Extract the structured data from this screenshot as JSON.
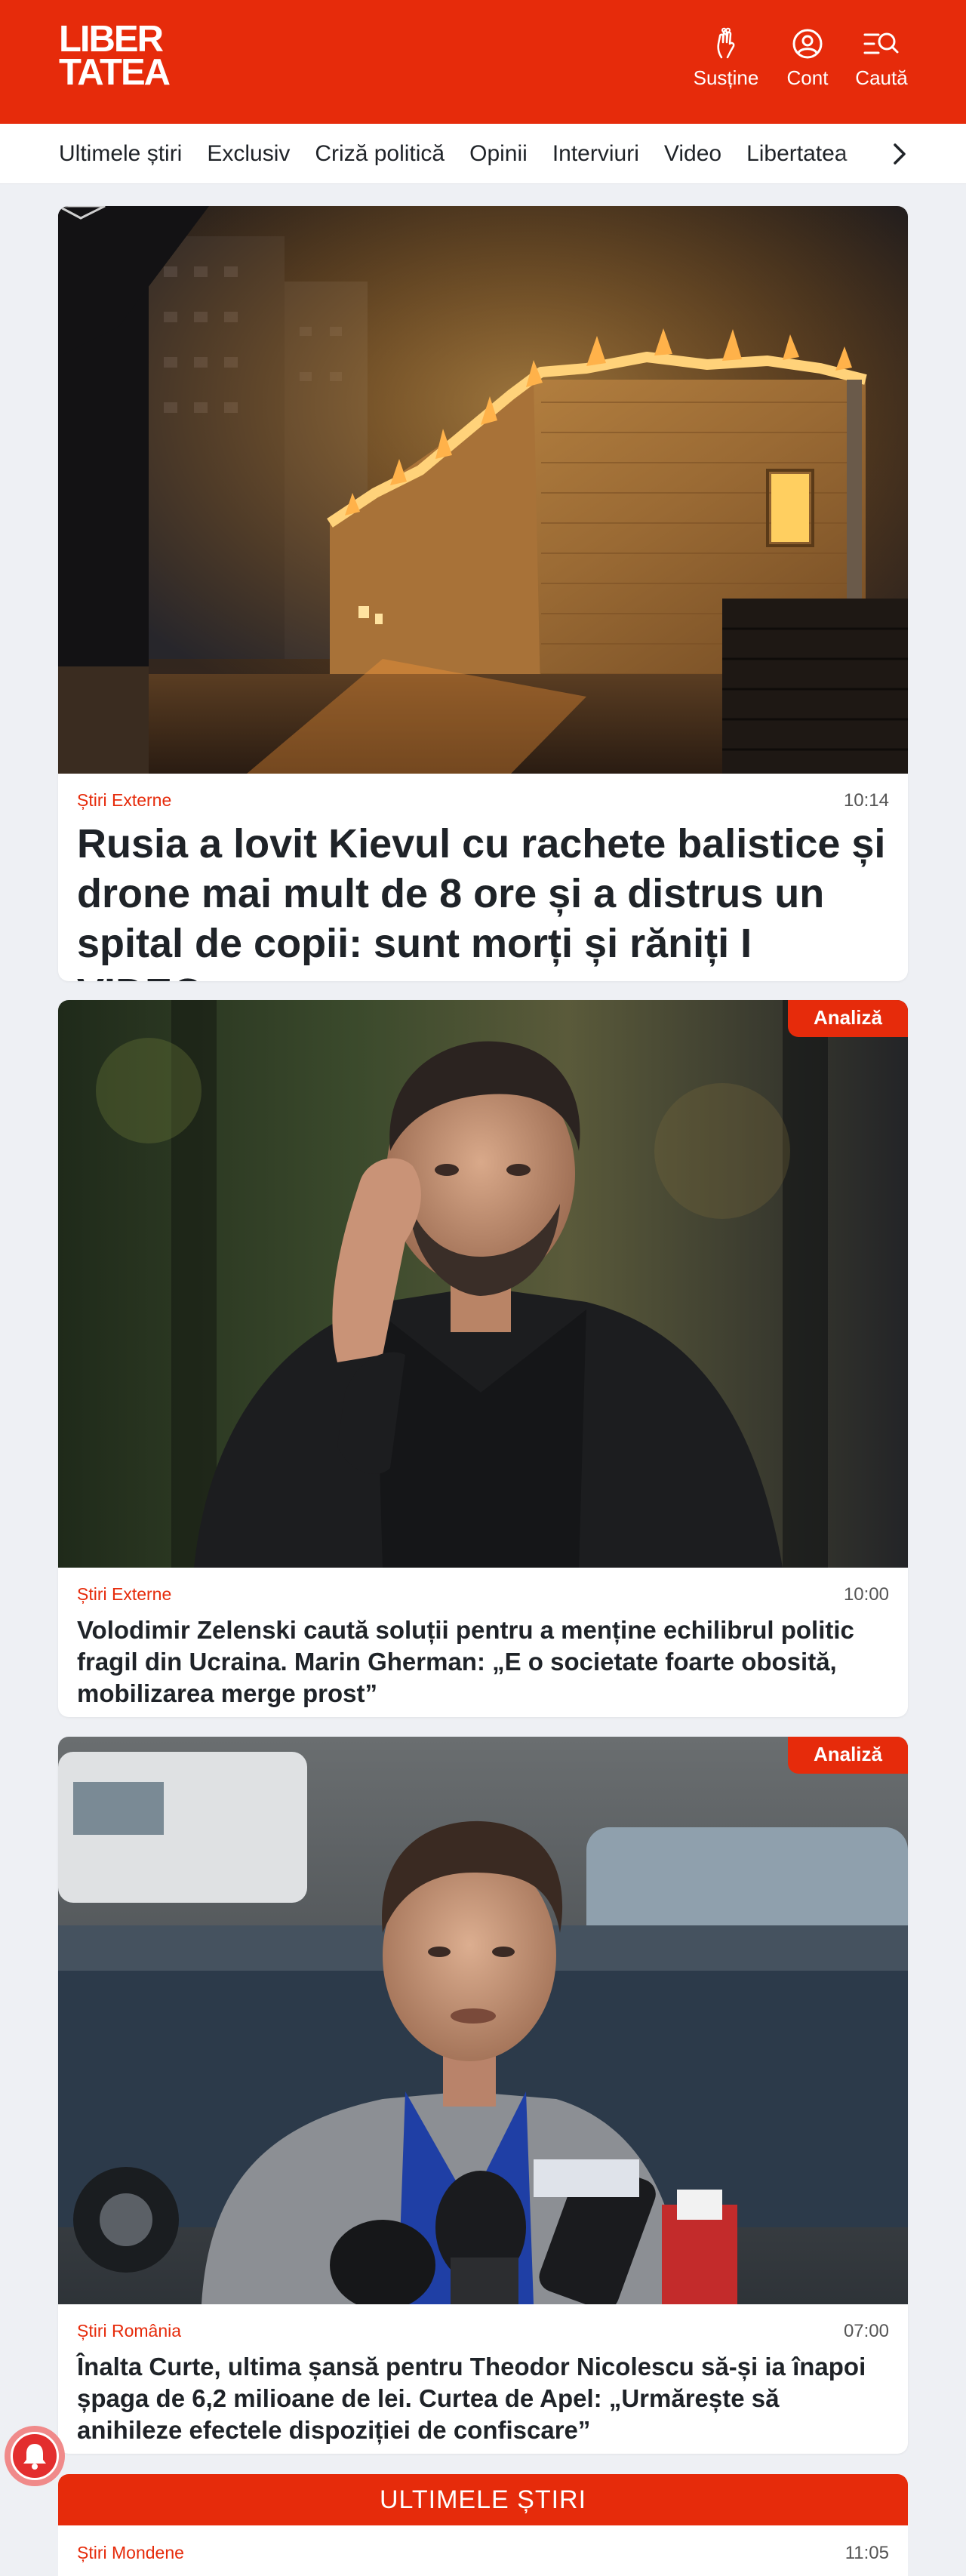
{
  "brand": {
    "logo_line1": "LIBER",
    "logo_line2": "TATEA",
    "color": "#e62b0b"
  },
  "header": {
    "buttons": [
      {
        "label": "Susține",
        "icon": "hand-heart-icon"
      },
      {
        "label": "Cont",
        "icon": "user-icon"
      },
      {
        "label": "Caută",
        "icon": "search-menu-icon"
      }
    ]
  },
  "nav": {
    "items": [
      "Ultimele știri",
      "Exclusiv",
      "Criză politică",
      "Opinii",
      "Interviuri",
      "Video",
      "Libertatea"
    ],
    "scroll_icon": "chevron-right-icon"
  },
  "articles": [
    {
      "category": "Știri Externe",
      "time": "10:14",
      "title": "Rusia a lovit Kievul cu rachete balistice și drone mai mult de 8 ore și a distrus un spital de copii: sunt morți și răniți I VIDEO",
      "image": "burning-building-photo"
    },
    {
      "badge": "Analiză",
      "category": "Știri Externe",
      "time": "10:00",
      "title": "Volodimir Zelenski caută soluții pentru a menține echilibrul politic fragil din Ucraina. Marin Gherman: „E o societate foarte obosită, mobilizarea merge prost”",
      "image": "zelensky-photo"
    },
    {
      "badge": "Analiză",
      "category": "Știri România",
      "time": "07:00",
      "title": "Înalta Curte, ultima șansă pentru Theodor Nicolescu să-și ia înapoi șpaga de 6,2 milioane de lei. Curtea de Apel: „Urmărește să anihileze efectele dispoziției de confiscare”",
      "image": "press-interview-photo"
    }
  ],
  "latest": {
    "heading": "ULTIMELE ȘTIRI",
    "first": {
      "category": "Știri Mondene",
      "time": "11:05"
    }
  },
  "notification_icon": "bell-icon"
}
